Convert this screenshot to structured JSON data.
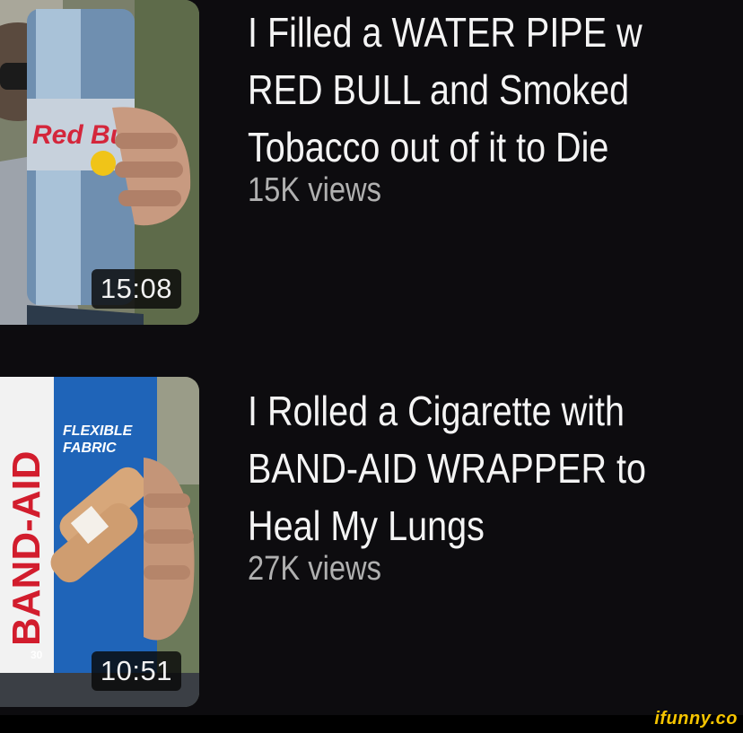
{
  "videos": [
    {
      "title_lines": [
        "I Filled a WATER PIPE w",
        "RED BULL and Smoked",
        "Tobacco out of it to Die"
      ],
      "views": "15K views",
      "duration": "15:08",
      "thumbnail_text": "Red Bu"
    },
    {
      "title_lines": [
        "I Rolled a Cigarette with",
        "BAND-AID WRAPPER to",
        "Heal My Lungs"
      ],
      "views": "27K views",
      "duration": "10:51",
      "thumbnail_text": [
        "BAND-AID",
        "FLEXIBLE",
        "FABRIC",
        "30"
      ]
    }
  ],
  "watermark": "ifunny.co",
  "colors": {
    "background": "#0d0c0f",
    "title": "#f4f4f4",
    "views": "#b0b0b0",
    "watermark": "#f5c400"
  }
}
